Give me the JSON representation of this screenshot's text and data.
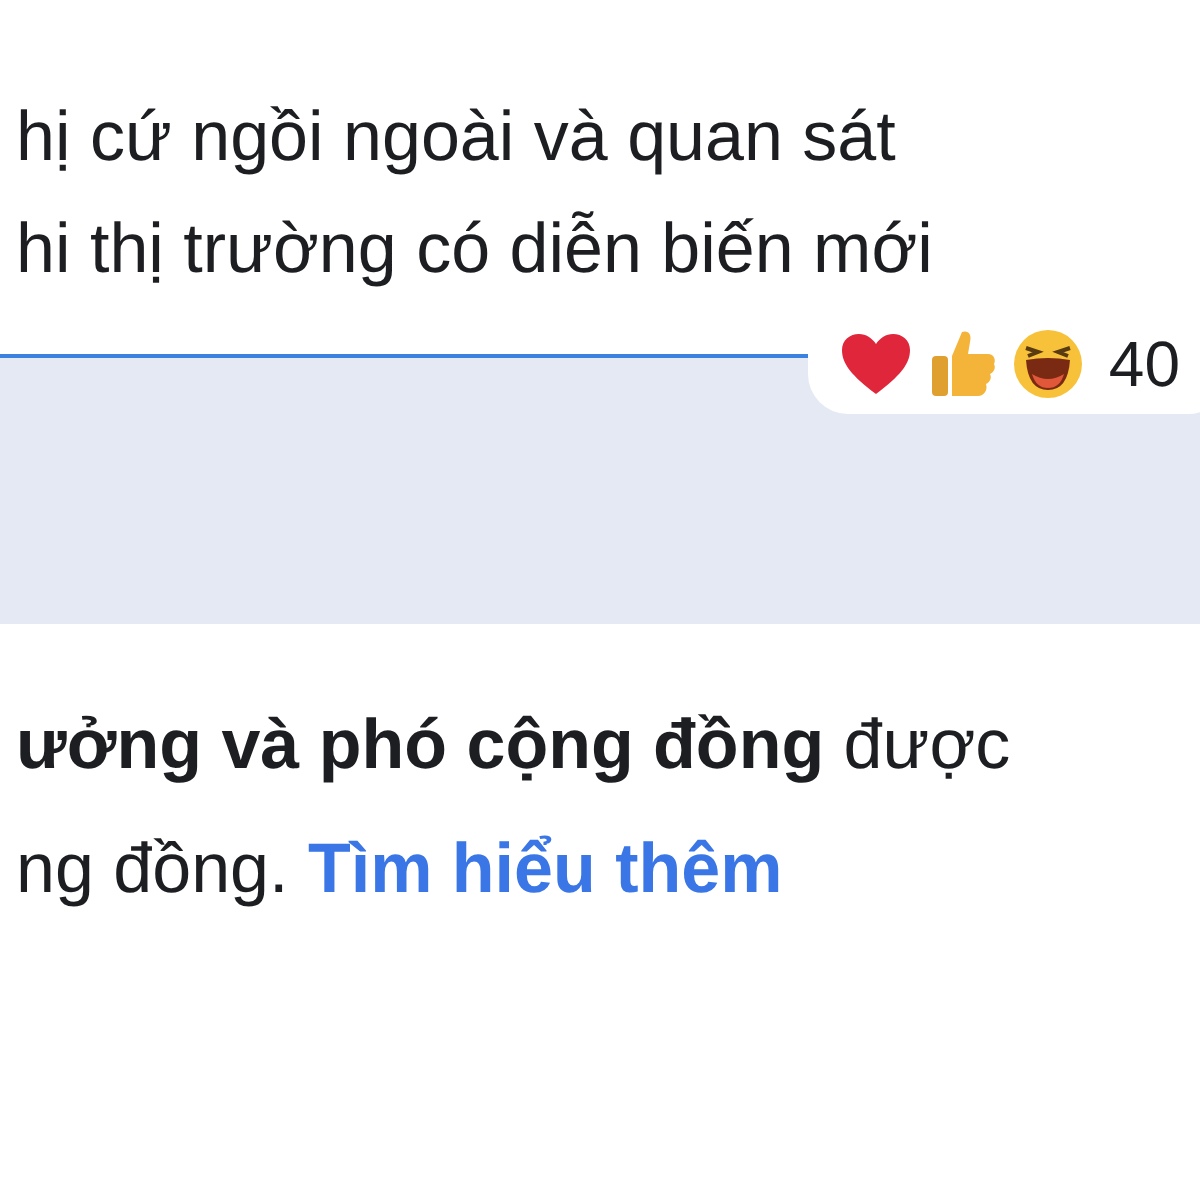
{
  "post": {
    "lines": [
      "hị cứ ngồi ngoài và quan sát",
      "hi thị trường có diễn biến mới"
    ]
  },
  "reactions": {
    "count": "40"
  },
  "notice": {
    "lines": [
      "**ưởng và phó cộng đồng** được",
      "ng đồng."
    ],
    "link": "Tìm hiểu thêm"
  }
}
